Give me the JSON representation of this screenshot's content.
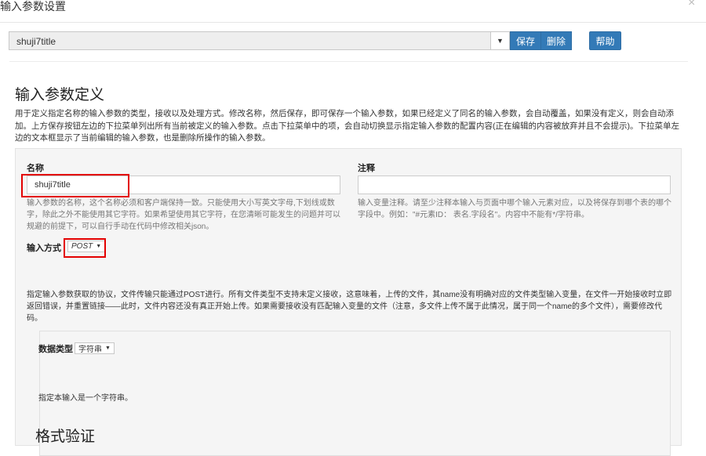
{
  "dialog": {
    "title": "输入参数设置",
    "close_glyph": "×"
  },
  "toolbar": {
    "selected_param": "shuji7title",
    "dropdown_glyph": "▼",
    "save_label": "保存",
    "delete_label": "删除",
    "help_label": "帮助"
  },
  "section": {
    "heading": "输入参数定义",
    "description": "用于定义指定名称的输入参数的类型，接收以及处理方式。修改名称，然后保存，即可保存一个输入参数，如果已经定义了同名的输入参数，会自动覆盖，如果没有定义，则会自动添加。上方保存按钮左边的下拉菜单列出所有当前被定义的输入参数。点击下拉菜单中的项，会自动切换显示指定输入参数的配置内容(正在编辑的内容被放弃并且不会提示)。下拉菜单左边的文本框显示了当前编辑的输入参数，也是删除所操作的输入参数。"
  },
  "form": {
    "name_label": "名称",
    "name_value": "shuji7title",
    "name_help": "输入参数的名称，这个名称必须和客户端保持一致。只能使用大小写英文字母,下划线或数字，除此之外不能使用其它字符。如果希望使用其它字符，在您清晰可能发生的问题并可以规避的前提下，可以自行手动在代码中修改相关json。",
    "note_label": "注释",
    "note_value": "",
    "note_help": "输入变量注释。请至少注释本输入与页面中哪个输入元素对应，以及将保存到哪个表的哪个字段中。例如：\"#元素ID： 表名.字段名\"。内容中不能有*/字符串。",
    "method_label": "输入方式",
    "method_value": "POST",
    "method_caret": "▼",
    "method_help": "指定输入参数获取的协议，文件传输只能通过POST进行。所有文件类型不支持未定义接收，这意味着，上传的文件，其name没有明确对应的文件类型输入变量，在文件一开始接收时立即返回错误，并重置链接——此时，文件内容还没有真正开始上传。如果需要接收没有匹配输入变量的文件（注意，多文件上传不属于此情况，属于同一个name的多个文件），需要修改代码。",
    "datatype_label": "数据类型",
    "datatype_value": "字符串",
    "datatype_caret": "▼",
    "datatype_help": "指定本输入是一个字符串。",
    "validation_heading": "格式验证"
  }
}
